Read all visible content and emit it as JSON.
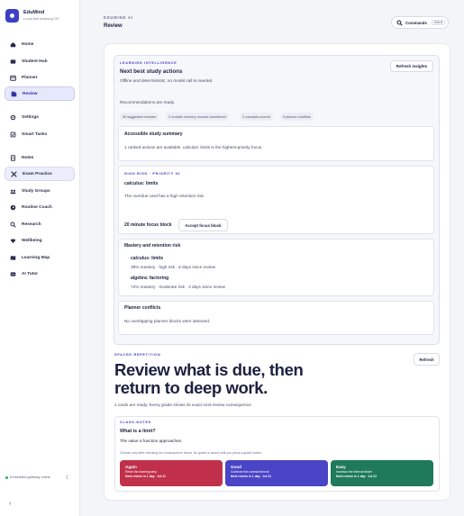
{
  "brand": {
    "name": "EduMind",
    "subtitle": "Local-first learning OS"
  },
  "nav": {
    "home": "Home",
    "student_hub": "Student Hub",
    "planner": "Planner",
    "review": "Review",
    "settings": "Settings",
    "smart_tasks": "Smart Tasks",
    "notes": "Notes",
    "exam_practice": "Exam Practice",
    "study_groups": "Study Groups",
    "routine_coach": "Routine Coach",
    "research": "Research",
    "wellbeing": "Wellbeing",
    "learning_map": "Learning Map",
    "ai_tutor": "AI Tutor"
  },
  "footer": {
    "gateway": "Embedded gateway online"
  },
  "header": {
    "eyebrow": "EDUMIND AI",
    "title": "Review",
    "commands": "Commands",
    "shortcut": "Ctrl K"
  },
  "learning": {
    "eyebrow": "LEARNING INTELLIGENCE",
    "title": "Next best study actions",
    "subtitle": "Offline and deterministic; no model call is needed.",
    "refresh": "Refresh insights",
    "status": "Recommendations are ready.",
    "chips": [
      "30 suggested minutes",
      "2 module memory records considered",
      "2 concepts scored",
      "0 planner conflicts"
    ],
    "summary": {
      "title": "Accessible study summary",
      "text": "1 ranked actions are available. calculus: limits is the highest-priority focus."
    },
    "priority": {
      "eyebrow": "HIGH RISK · PRIORITY 92",
      "title": "calculus: limits",
      "text": "The overdue card has a high retention risk.",
      "focus": "20 minute focus block",
      "accept": "Accept focus block"
    },
    "mastery": {
      "title": "Mastery and retention risk",
      "items": [
        {
          "name": "calculus: limits",
          "detail": "38% mastery · high risk · 8 days since review"
        },
        {
          "name": "algebra: factoring",
          "detail": "72% mastery · moderate risk · 3 days since review"
        }
      ]
    },
    "conflicts": {
      "title": "Planner conflicts",
      "text": "No overlapping planner blocks were detected."
    }
  },
  "spaced": {
    "eyebrow": "SPACED REPETITION",
    "refresh": "Refresh",
    "headline": "Review what is due, then return to deep work.",
    "status": "1 cards are ready. Every grade shows its exact next-review consequence.",
    "card": {
      "tag": "CLASS-NOTES",
      "question": "What is a limit?",
      "answer": "The value a function approaches.",
      "hint": "Choose only after checking the consequence below. No grade is saved until you press a grade button."
    },
    "grades": [
      {
        "title": "Again",
        "desc": "Reset the learning step",
        "next": "Next review in 1 day · Jul 21",
        "color": "#c0304a"
      },
      {
        "title": "Good",
        "desc": "Continue the normal interval",
        "next": "Next review in 1 day · Jul 21",
        "color": "#4a44c6"
      },
      {
        "title": "Easy",
        "desc": "Increase the interval faster",
        "next": "Next review in 1 day · Jul 21",
        "color": "#1f7a5c"
      }
    ]
  },
  "colors": {
    "accent": "#3d3fc4",
    "active_bg": "#e6e8fb",
    "online": "#2ab36b"
  }
}
